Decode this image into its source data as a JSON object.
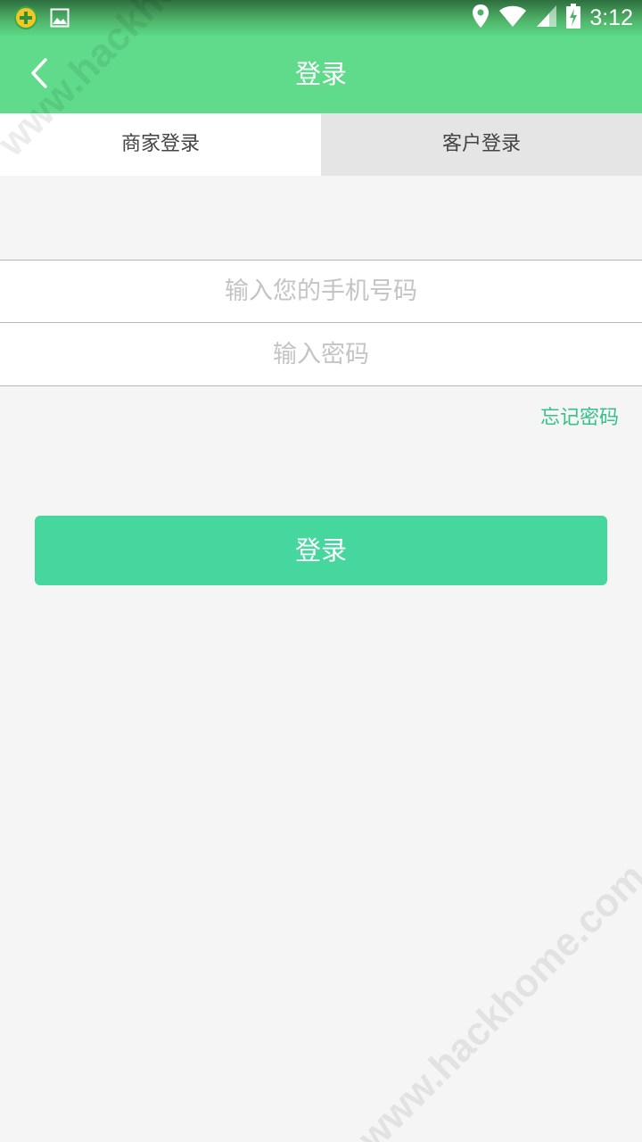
{
  "status_bar": {
    "time": "3:12",
    "left_icons": [
      "app-notification-icon",
      "image-icon"
    ],
    "right_icons": [
      "location-icon",
      "wifi-icon",
      "signal-icon",
      "battery-charging-icon"
    ]
  },
  "app_bar": {
    "title": "登录",
    "back_icon": "chevron-left-icon",
    "color": "#5fdb8b"
  },
  "tabs": [
    {
      "label": "商家登录",
      "active": true
    },
    {
      "label": "客户登录",
      "active": false
    }
  ],
  "form": {
    "phone": {
      "value": "",
      "placeholder": "输入您的手机号码"
    },
    "password": {
      "value": "",
      "placeholder": "输入密码"
    },
    "forgot_label": "忘记密码",
    "submit_label": "登录",
    "accent_color": "#46d79f"
  },
  "watermark": {
    "text": "www.hackhome.com"
  }
}
